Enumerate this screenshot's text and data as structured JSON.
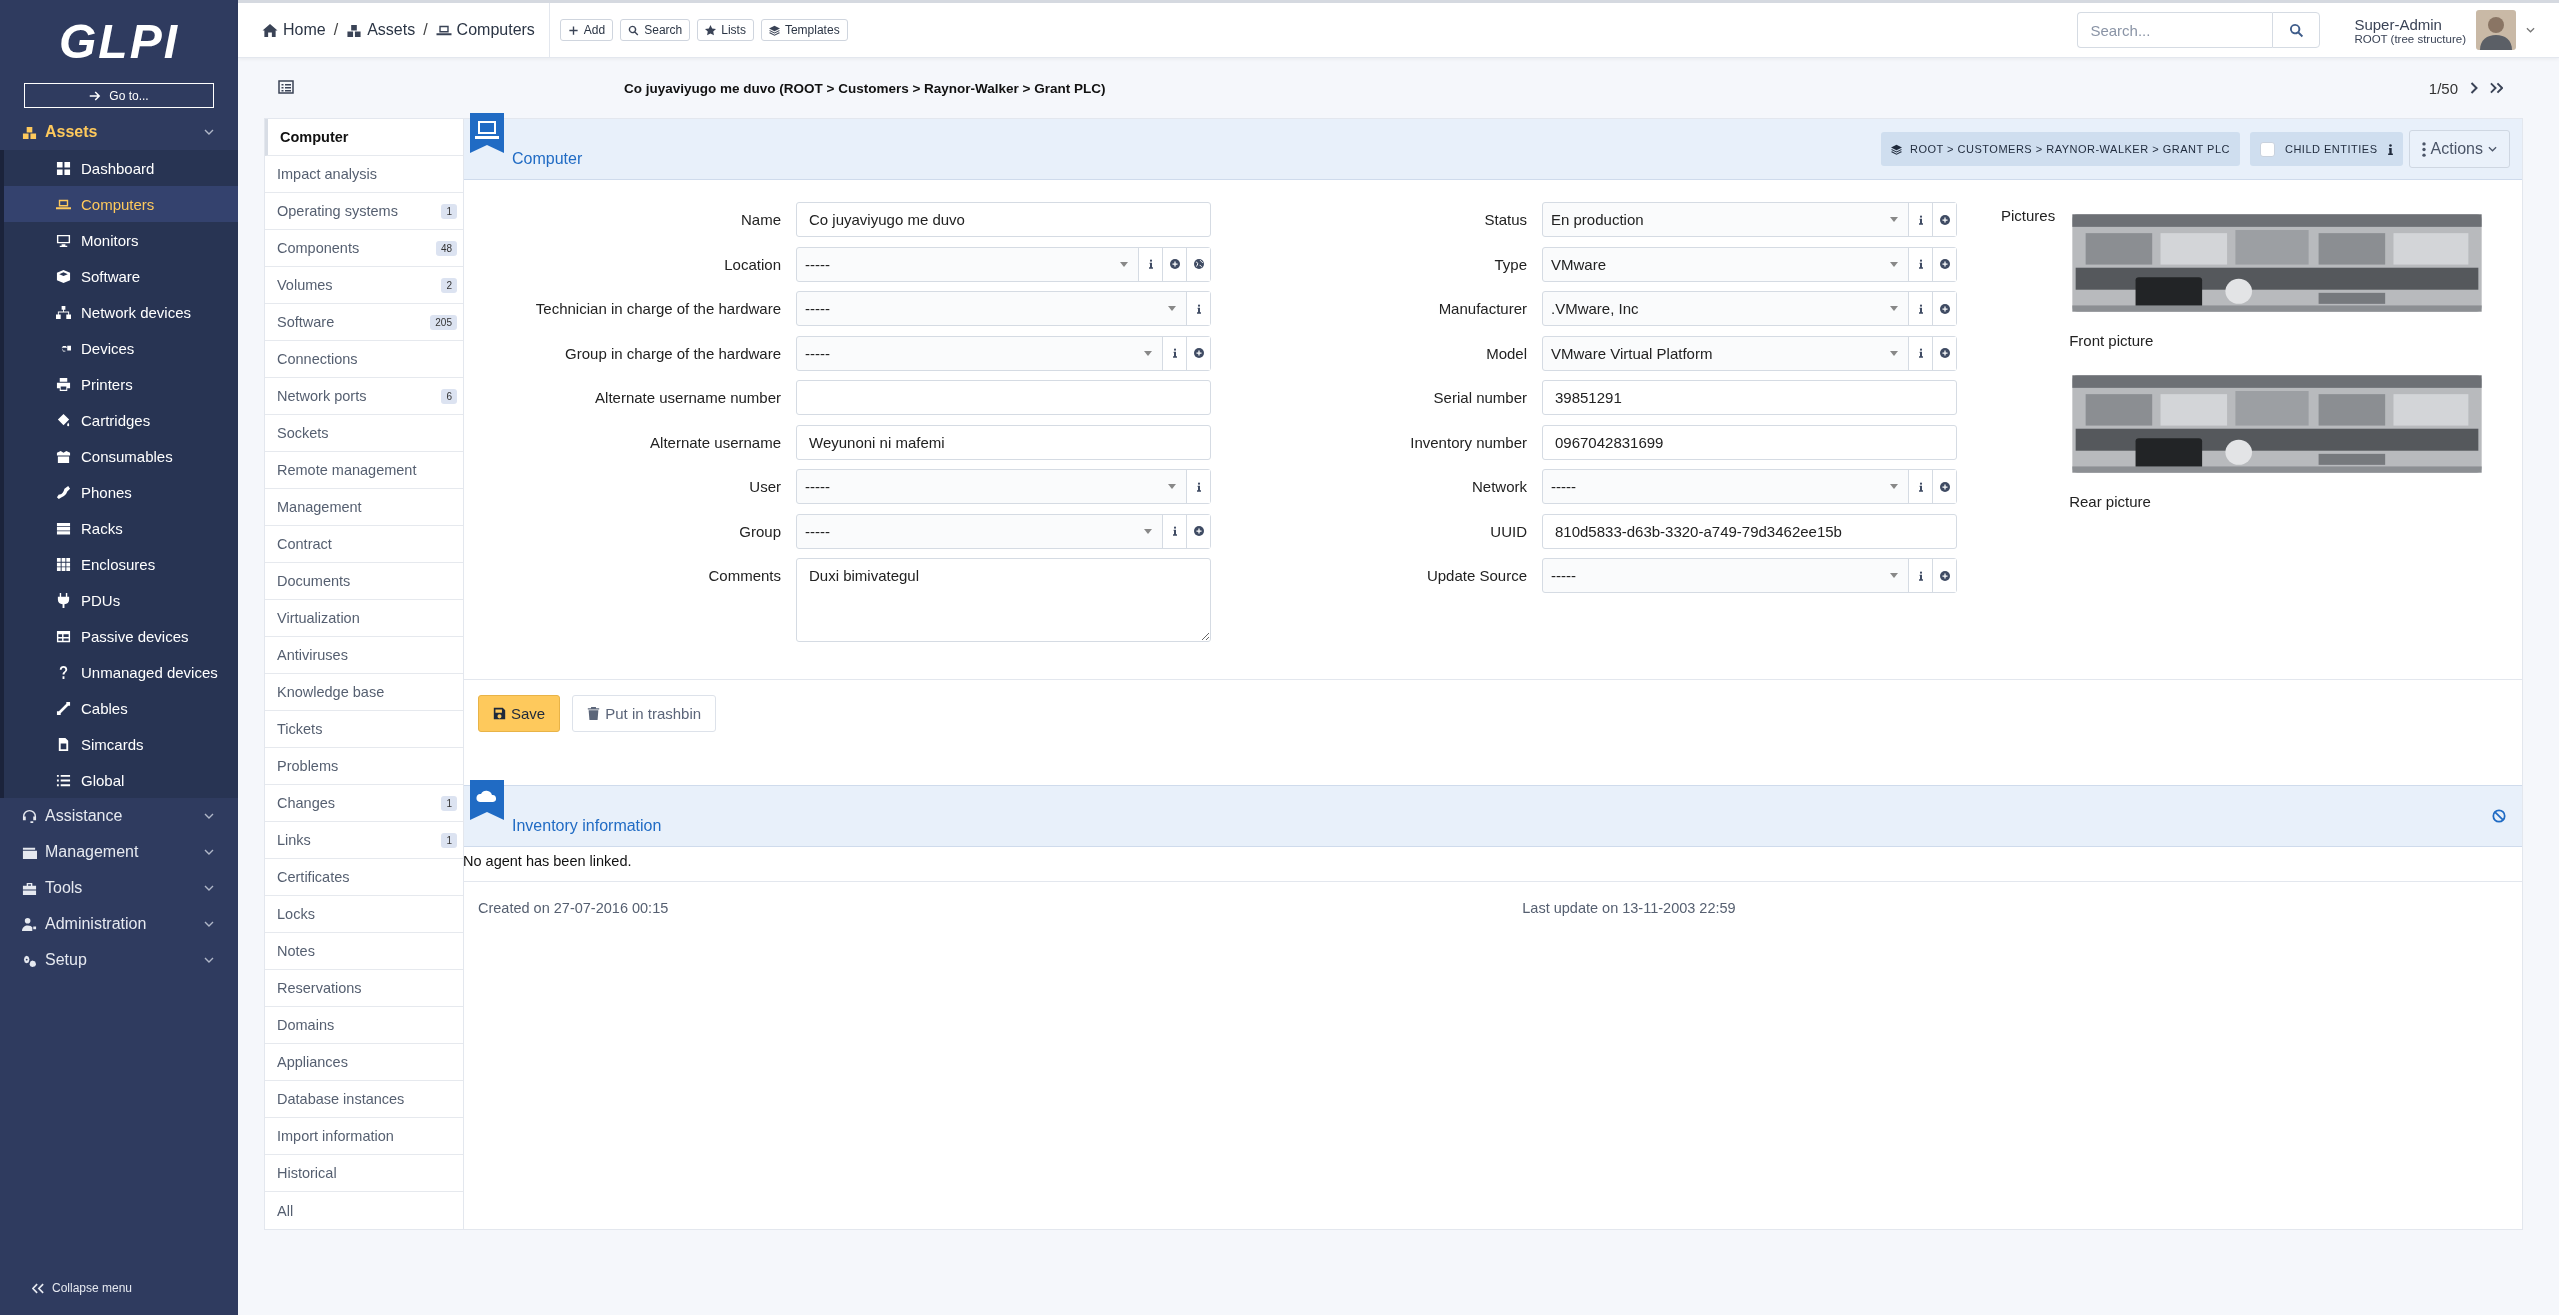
{
  "sidebar": {
    "logo": "GLPI",
    "goto": "Go to...",
    "sections": [
      {
        "label": "Assets",
        "expanded": true,
        "children": [
          {
            "label": "Dashboard",
            "selected": false
          },
          {
            "label": "Computers",
            "selected": true
          },
          {
            "label": "Monitors",
            "selected": false
          },
          {
            "label": "Software",
            "selected": false
          },
          {
            "label": "Network devices",
            "selected": false
          },
          {
            "label": "Devices",
            "selected": false
          },
          {
            "label": "Printers",
            "selected": false
          },
          {
            "label": "Cartridges",
            "selected": false
          },
          {
            "label": "Consumables",
            "selected": false
          },
          {
            "label": "Phones",
            "selected": false
          },
          {
            "label": "Racks",
            "selected": false
          },
          {
            "label": "Enclosures",
            "selected": false
          },
          {
            "label": "PDUs",
            "selected": false
          },
          {
            "label": "Passive devices",
            "selected": false
          },
          {
            "label": "Unmanaged devices",
            "selected": false
          },
          {
            "label": "Cables",
            "selected": false
          },
          {
            "label": "Simcards",
            "selected": false
          },
          {
            "label": "Global",
            "selected": false
          }
        ]
      },
      {
        "label": "Assistance",
        "expanded": false
      },
      {
        "label": "Management",
        "expanded": false
      },
      {
        "label": "Tools",
        "expanded": false
      },
      {
        "label": "Administration",
        "expanded": false
      },
      {
        "label": "Setup",
        "expanded": false
      }
    ],
    "collapse": "Collapse menu"
  },
  "header": {
    "breadcrumb": [
      {
        "label": "Home"
      },
      {
        "label": "Assets"
      },
      {
        "label": "Computers"
      }
    ],
    "separator": "/",
    "actions": [
      "Add",
      "Search",
      "Lists",
      "Templates"
    ],
    "search": {
      "placeholder": "Search..."
    },
    "user": {
      "name": "Super-Admin",
      "profile": "ROOT (tree structure)"
    }
  },
  "title": "Co juyaviyugo me duvo (ROOT > Customers > Raynor-Walker > Grant PLC)",
  "pager": "1/50",
  "tabs": [
    {
      "label": "Computer",
      "selected": true
    },
    {
      "label": "Impact analysis",
      "selected": false
    },
    {
      "label": "Operating systems",
      "count": "1",
      "selected": false
    },
    {
      "label": "Components",
      "count": "48",
      "selected": false
    },
    {
      "label": "Volumes",
      "count": "2",
      "selected": false
    },
    {
      "label": "Software",
      "count": "205",
      "selected": false
    },
    {
      "label": "Connections",
      "selected": false
    },
    {
      "label": "Network ports",
      "count": "6",
      "selected": false
    },
    {
      "label": "Sockets",
      "selected": false
    },
    {
      "label": "Remote management",
      "selected": false
    },
    {
      "label": "Management",
      "selected": false
    },
    {
      "label": "Contract",
      "selected": false
    },
    {
      "label": "Documents",
      "selected": false
    },
    {
      "label": "Virtualization",
      "selected": false
    },
    {
      "label": "Antiviruses",
      "selected": false
    },
    {
      "label": "Knowledge base",
      "selected": false
    },
    {
      "label": "Tickets",
      "selected": false
    },
    {
      "label": "Problems",
      "selected": false
    },
    {
      "label": "Changes",
      "count": "1",
      "selected": false
    },
    {
      "label": "Links",
      "count": "1",
      "selected": false
    },
    {
      "label": "Certificates",
      "selected": false
    },
    {
      "label": "Locks",
      "selected": false
    },
    {
      "label": "Notes",
      "selected": false
    },
    {
      "label": "Reservations",
      "selected": false
    },
    {
      "label": "Domains",
      "selected": false
    },
    {
      "label": "Appliances",
      "selected": false
    },
    {
      "label": "Database instances",
      "selected": false
    },
    {
      "label": "Import information",
      "selected": false
    },
    {
      "label": "Historical",
      "selected": false
    },
    {
      "label": "All",
      "selected": false
    }
  ],
  "panel": {
    "title": "Computer",
    "entity": "ROOT > CUSTOMERS > RAYNOR-WALKER > GRANT PLC",
    "child_entities": {
      "label": "CHILD ENTITIES",
      "checked": false
    },
    "actions": "Actions",
    "left_fields": [
      {
        "kind": "text",
        "label": "Name",
        "value": "Co juyaviyugo me duvo"
      },
      {
        "kind": "dropdown",
        "label": "Location",
        "value": "-----",
        "info": true,
        "add": true,
        "locate": true
      },
      {
        "kind": "dropdown",
        "label": "Technician in charge of the hardware",
        "value": "-----",
        "info": true
      },
      {
        "kind": "dropdown",
        "label": "Group in charge of the hardware",
        "value": "-----",
        "info": true,
        "add": true
      },
      {
        "kind": "text",
        "label": "Alternate username number"
      },
      {
        "kind": "text",
        "label": "Alternate username",
        "value": "Weyunoni ni mafemi"
      },
      {
        "kind": "dropdown",
        "label": "User",
        "value": "-----",
        "info": true
      },
      {
        "kind": "dropdown",
        "label": "Group",
        "value": "-----",
        "info": true,
        "add": true
      },
      {
        "kind": "textarea",
        "label": "Comments",
        "value": "Duxi bimivategul"
      }
    ],
    "right_fields": [
      {
        "kind": "dropdown",
        "label": "Status",
        "value": "En production",
        "info": true,
        "add": true
      },
      {
        "kind": "dropdown",
        "label": "Type",
        "value": "VMware",
        "info": true,
        "add": true
      },
      {
        "kind": "dropdown",
        "label": "Manufacturer",
        "value": ".VMware, Inc",
        "info": true,
        "add": true
      },
      {
        "kind": "dropdown",
        "label": "Model",
        "value": "VMware Virtual Platform",
        "info": true,
        "add": true
      },
      {
        "kind": "text",
        "label": "Serial number",
        "value": "39851291"
      },
      {
        "kind": "text",
        "label": "Inventory number",
        "value": "0967042831699"
      },
      {
        "kind": "dropdown",
        "label": "Network",
        "value": "-----",
        "info": true,
        "add": true
      },
      {
        "kind": "text",
        "label": "UUID",
        "value": "810d5833-d63b-3320-a749-79d3462ee15b"
      },
      {
        "kind": "dropdown",
        "label": "Update Source",
        "value": "-----",
        "info": true,
        "add": true
      }
    ],
    "pictures": {
      "label": "Pictures",
      "items": [
        {
          "caption": "Front picture"
        },
        {
          "caption": "Rear picture"
        }
      ]
    },
    "buttons": [
      {
        "kind": "save",
        "label": "Save"
      },
      {
        "kind": "trash",
        "label": "Put in trashbin"
      }
    ]
  },
  "inventory": {
    "title": "Inventory information",
    "message": "No agent has been linked."
  },
  "footer": {
    "created": "Created on 27-07-2016 00:15",
    "updated": "Last update on 13-11-2003 22:59"
  }
}
